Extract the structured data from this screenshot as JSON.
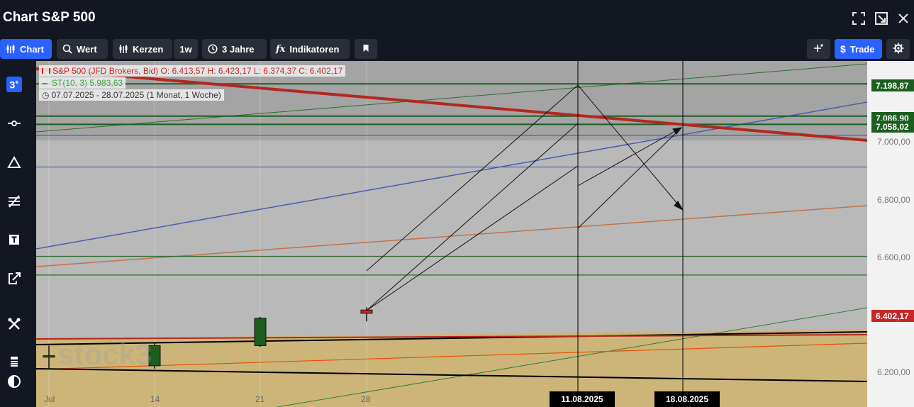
{
  "window": {
    "title": "Chart S&P 500"
  },
  "toolbar": {
    "chart_label": "Chart",
    "value_label": "Wert",
    "candles_label": "Kerzen",
    "interval_label": "1w",
    "range_label": "3 Jahre",
    "indicators_label": "Indikatoren",
    "trade_label": "Trade"
  },
  "legend": {
    "main": "S&P 500 (JFD Brokers, Bid)  O: 6.413,57  H: 6.423,17  L: 6.374,37  C: 6.402,17",
    "supertrend": "ST(10, 3)  5.983,63",
    "period": "07.07.2025 - 28.07.2025   (1 Monat, 1 Woche)"
  },
  "price_axis": {
    "ticks": [
      "7.000,00",
      "6.800,00",
      "6.600,00",
      "6.200,00"
    ],
    "tag_7198": "7.198,87",
    "tag_7086": "7.086,90",
    "tag_7058": "7.058,02",
    "tag_6402": "6.402,17"
  },
  "time_axis": {
    "labels": [
      "Jul",
      "14",
      "21",
      "28"
    ],
    "date_tag_1": "11.08.2025",
    "date_tag_2": "18.08.2025"
  },
  "watermark": "stock3",
  "colors": {
    "accent": "#2962ff",
    "bullish": "#1b5e20",
    "bearish": "#c62828",
    "trend_red": "#b3281f",
    "chart_bg": "#b9b9b9",
    "zone_fill": "#cdb57a"
  },
  "chart_data": {
    "type": "candlestick",
    "interval": "1w",
    "candles": [
      {
        "x": "Jul",
        "open": 6250,
        "high": 6290,
        "low": 6210,
        "close": 6255
      },
      {
        "x": "14",
        "open": 6220,
        "high": 6300,
        "low": 6210,
        "close": 6290
      },
      {
        "x": "21",
        "open": 6290,
        "high": 6390,
        "low": 6285,
        "close": 6385
      },
      {
        "x": "28",
        "open": 6413.57,
        "high": 6423.17,
        "low": 6374.37,
        "close": 6402.17
      }
    ],
    "ylim": [
      6100,
      7300
    ],
    "horizontal_levels": [
      7198.87,
      7086.9,
      7058.02,
      7020,
      6910,
      6600,
      6535
    ],
    "vertical_markers": [
      "11.08.2025",
      "18.08.2025"
    ]
  }
}
